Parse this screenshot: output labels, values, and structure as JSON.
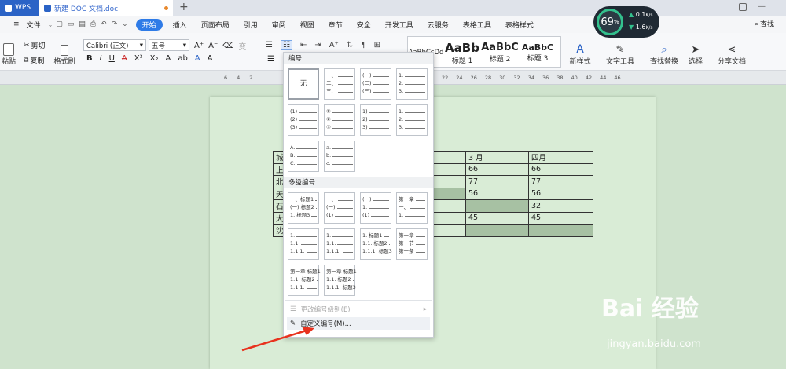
{
  "titlebar": {
    "wps_tab": "WPS",
    "doc_tab": "新建 DOC 文档.doc",
    "search": "查找"
  },
  "menubar": {
    "file": "文件",
    "items": [
      "开始",
      "插入",
      "页面布局",
      "引用",
      "审阅",
      "视图",
      "章节",
      "安全",
      "开发工具",
      "云服务",
      "表格工具",
      "表格样式"
    ]
  },
  "ribbon": {
    "paste": "粘贴",
    "cut": "剪切",
    "copy": "复制",
    "format_painter": "格式刷",
    "font_name": "Calibri (正文)",
    "font_size": "五号",
    "styles": [
      {
        "preview": "AaBbCcDd",
        "label": ""
      },
      {
        "preview": "AaBb",
        "label": "标题 1"
      },
      {
        "preview": "AaBbC",
        "label": "标题 2"
      },
      {
        "preview": "AaBbC",
        "label": "标题 3"
      }
    ],
    "new_style": "新样式",
    "text_tool": "文字工具",
    "find_replace": "查找替换",
    "select": "选择",
    "share": "分享文档"
  },
  "gauge": {
    "percent": "69",
    "unit": "%",
    "up": "0.1",
    "down": "1.6",
    "speed_unit": "K/s"
  },
  "ruler": {
    "left_ticks": [
      "6",
      "4",
      "2"
    ],
    "right_ticks": [
      "22",
      "24",
      "26",
      "28",
      "30",
      "32",
      "34",
      "36",
      "38",
      "40",
      "42",
      "44",
      "46"
    ]
  },
  "table": {
    "rows": [
      [
        "城",
        "",
        "3 月",
        "四月"
      ],
      [
        "上",
        "",
        "66",
        "66"
      ],
      [
        "北",
        "",
        "77",
        "77"
      ],
      [
        "天",
        "",
        "56",
        "56"
      ],
      [
        "石",
        "",
        "",
        "32"
      ],
      [
        "大",
        "",
        "45",
        "45"
      ],
      [
        "沈",
        "",
        "",
        ""
      ]
    ]
  },
  "dropdown": {
    "section_numbering": "编号",
    "none_label": "无",
    "section_multilevel": "多级编号",
    "change_level": "更改编号级别(E)",
    "custom": "自定义编号(M)...",
    "cells": [
      {
        "lines": [
          "一、",
          "二、",
          "三、"
        ]
      },
      {
        "lines": [
          "(一)",
          "(二)",
          "(三)"
        ]
      },
      {
        "lines": [
          "1.",
          "2.",
          "3."
        ]
      },
      {
        "lines": [
          "(1)",
          "(2)",
          "(3)"
        ]
      },
      {
        "lines": [
          "①",
          "②",
          "③"
        ]
      },
      {
        "lines": [
          "1)",
          "2)",
          "3)"
        ]
      },
      {
        "lines": [
          "1.",
          "2.",
          "3."
        ]
      },
      {
        "lines": [
          "A.",
          "B.",
          "C."
        ]
      },
      {
        "lines": [
          "a.",
          "b.",
          "c."
        ]
      }
    ],
    "multi_cells": [
      {
        "lines": [
          "一、标题1",
          "(一) 标题2",
          "1. 标题3"
        ]
      },
      {
        "lines": [
          "一、",
          "(一)",
          "(1)"
        ]
      },
      {
        "lines": [
          "(一)",
          "1.",
          "(1)"
        ]
      },
      {
        "lines": [
          "第一章",
          "一、",
          "1."
        ]
      },
      {
        "lines": [
          "1.",
          "1.1.",
          "1.1.1."
        ]
      },
      {
        "lines": [
          "1.",
          "1.1.",
          "1.1.1."
        ]
      },
      {
        "lines": [
          "1. 标题1",
          "1.1. 标题2",
          "1.1.1. 标题3"
        ]
      },
      {
        "lines": [
          "第一章",
          "第一节",
          "第一条"
        ]
      },
      {
        "lines": [
          "第一章 标题1",
          "1.1. 标题2",
          "1.1.1."
        ]
      },
      {
        "lines": [
          "第一章 标题1",
          "1.1. 标题2",
          "1.1.1. 标题3"
        ]
      }
    ]
  },
  "watermark": {
    "brand": "Bai 经验",
    "url": "jingyan.baidu.com"
  },
  "colors": {
    "accent": "#2e7be7",
    "doc_bg": "#cfe3cd",
    "page_bg": "#d9ecd6",
    "arrow": "#e8321e"
  }
}
